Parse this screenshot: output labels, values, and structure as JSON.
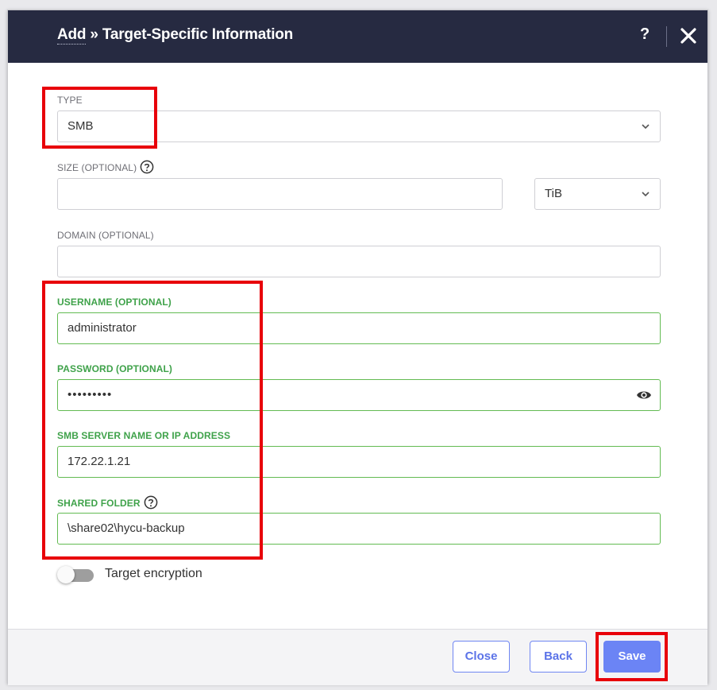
{
  "dialog": {
    "title_link": "Add",
    "title_rest": " » Target-Specific Information",
    "help_label": "?"
  },
  "form": {
    "type": {
      "label": "TYPE",
      "value": "SMB"
    },
    "size": {
      "label": "SIZE (OPTIONAL)",
      "value": "",
      "unit": "TiB"
    },
    "domain": {
      "label": "DOMAIN (OPTIONAL)",
      "value": ""
    },
    "username": {
      "label": "USERNAME (OPTIONAL)",
      "value": "administrator"
    },
    "password": {
      "label": "PASSWORD (OPTIONAL)",
      "value": "•••••••••"
    },
    "server": {
      "label": "SMB SERVER NAME OR IP ADDRESS",
      "value": "172.22.1.21"
    },
    "shared_folder": {
      "label": "SHARED FOLDER",
      "value": "\\share02\\hycu-backup"
    },
    "encryption": {
      "label": "Target encryption",
      "enabled": false
    }
  },
  "footer": {
    "close_label": "Close",
    "back_label": "Back",
    "save_label": "Save"
  },
  "colors": {
    "header_bg": "#262a41",
    "accent": "#6b84f5",
    "valid_green": "#63bb52",
    "highlight_red": "#e8000a"
  }
}
